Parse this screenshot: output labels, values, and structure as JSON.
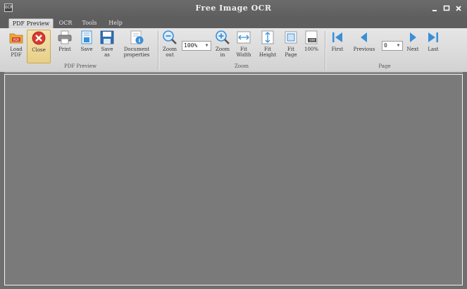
{
  "window": {
    "title": "Free Image OCR",
    "app_icon_text": "OCR"
  },
  "tabs": [
    {
      "label": "PDF Preview",
      "active": true
    },
    {
      "label": "OCR",
      "active": false
    },
    {
      "label": "Tools",
      "active": false
    },
    {
      "label": "Help",
      "active": false
    }
  ],
  "ribbon": {
    "pdf_preview": {
      "group_label": "PDF Preview",
      "load_pdf": "Load\nPDF",
      "close": "Close",
      "print": "Print",
      "save": "Save",
      "save_as": "Save\nas",
      "document_properties": "Document\nproperties"
    },
    "zoom": {
      "group_label": "Zoom",
      "zoom_out": "Zoom\nout",
      "zoom_value": "100%",
      "zoom_in": "Zoom\nin",
      "fit_width": "Fit\nWidth",
      "fit_height": "Fit\nHeight",
      "fit_page": "Fit\nPage",
      "hundred": "100%",
      "hundred_icon_text": "100"
    },
    "page": {
      "group_label": "Page",
      "first": "First",
      "previous": "Previous",
      "page_value": "0",
      "next": "Next",
      "last": "Last"
    }
  },
  "colors": {
    "accent_blue": "#3a8fd8",
    "close_red": "#d83a2e",
    "pdf_orange": "#e8a93a"
  }
}
